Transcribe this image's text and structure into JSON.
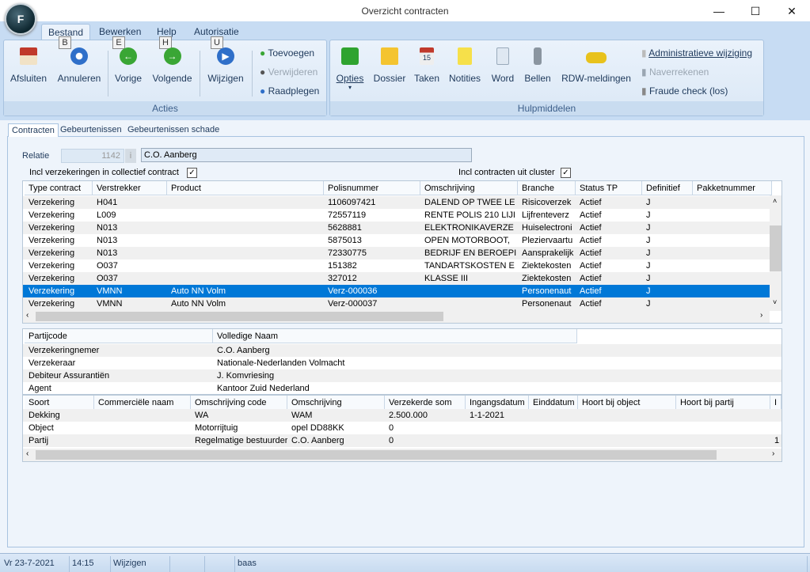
{
  "window": {
    "title": "Overzicht contracten",
    "minimize": "—",
    "maximize": "☐",
    "close": "✕",
    "app_letter": "F"
  },
  "ribbon": {
    "tabs": [
      "Bestand",
      "Bewerken",
      "Help",
      "Autorisatie"
    ],
    "keytips": [
      "B",
      "E",
      "H",
      "U"
    ],
    "acties": {
      "label": "Acties",
      "buttons": [
        "Afsluiten",
        "Annuleren",
        "Vorige",
        "Volgende",
        "Wijzigen"
      ],
      "small": [
        "Toevoegen",
        "Verwijderen",
        "Raadplegen"
      ]
    },
    "hulpmiddelen": {
      "label": "Hulpmiddelen",
      "buttons": [
        "Opties",
        "Dossier",
        "Taken",
        "Notities",
        "Word",
        "Bellen",
        "RDW-meldingen"
      ],
      "small": [
        "Administratieve wijziging",
        "Naverrekenen",
        "Fraude check (los)"
      ]
    }
  },
  "page_tabs": [
    "Contracten",
    "Gebeurtenissen",
    "Gebeurtenissen schade"
  ],
  "relatie": {
    "label": "Relatie",
    "number": "1142",
    "name": "C.O. Aanberg"
  },
  "options": {
    "collectief_label": "Incl verzekeringen in collectief contract",
    "collectief_checked": true,
    "cluster_label": "Incl contracten uit cluster",
    "cluster_checked": true,
    "check": "✓"
  },
  "contracts": {
    "columns": [
      "Type contract",
      "Verstrekker",
      "Product",
      "Polisnummer",
      "Omschrijving",
      "Branche",
      "Status TP",
      "Definitief",
      "Pakketnummer"
    ],
    "rows": [
      [
        "Verzekering",
        "H041",
        "",
        "1106097421",
        "DALEND OP TWEE LE",
        "Risicoverzek",
        "Actief",
        "J",
        ""
      ],
      [
        "Verzekering",
        "L009",
        "",
        "72557119",
        "RENTE POLIS 210 LIJI",
        "Lijfrenteverz",
        "Actief",
        "J",
        ""
      ],
      [
        "Verzekering",
        "N013",
        "",
        "5628881",
        "ELEKTRONIKAVERZE",
        "Huiselectroni",
        "Actief",
        "J",
        ""
      ],
      [
        "Verzekering",
        "N013",
        "",
        "5875013",
        "OPEN MOTORBOOT,",
        "Pleziervaartu",
        "Actief",
        "J",
        ""
      ],
      [
        "Verzekering",
        "N013",
        "",
        "72330775",
        "BEDRIJF EN BEROEPI",
        "Aansprakelijk",
        "Actief",
        "J",
        ""
      ],
      [
        "Verzekering",
        "O037",
        "",
        "151382",
        "TANDARTSKOSTEN E",
        "Ziektekosten",
        "Actief",
        "J",
        ""
      ],
      [
        "Verzekering",
        "O037",
        "",
        "327012",
        "KLASSE III",
        "Ziektekosten",
        "Actief",
        "J",
        ""
      ],
      [
        "Verzekering",
        "VMNN",
        "Auto NN Volm",
        "Verz-000036",
        "",
        "Personenaut",
        "Actief",
        "J",
        ""
      ],
      [
        "Verzekering",
        "VMNN",
        "Auto NN Volm",
        "Verz-000037",
        "",
        "Personenaut",
        "Actief",
        "J",
        ""
      ]
    ],
    "selected_index": 7
  },
  "parties": {
    "columns": [
      "Partijcode",
      "Volledige Naam"
    ],
    "rows": [
      [
        "Verzekeringnemer",
        "C.O. Aanberg"
      ],
      [
        "Verzekeraar",
        "Nationale-Nederlanden Volmacht"
      ],
      [
        "Debiteur Assurantiën",
        "J. Komvriesing"
      ],
      [
        "Agent",
        "Kantoor Zuid Nederland"
      ]
    ]
  },
  "details": {
    "columns": [
      "Soort",
      "Commerciële naam",
      "Omschrijving code",
      "Omschrijving",
      "Verzekerde som",
      "Ingangsdatum",
      "Einddatum",
      "Hoort bij object",
      "Hoort bij partij",
      "I"
    ],
    "rows": [
      [
        "Dekking",
        "",
        "WA",
        "WAM",
        "2.500.000",
        "1-1-2021",
        "",
        "",
        "",
        ""
      ],
      [
        "Object",
        "",
        "Motorrijtuig",
        "opel DD88KK",
        "0",
        "",
        "",
        "",
        "",
        ""
      ],
      [
        "Partij",
        "",
        "Regelmatige bestuurder",
        "C.O. Aanberg",
        "0",
        "",
        "",
        "",
        "",
        "1"
      ]
    ]
  },
  "statusbar": [
    "Vr 23-7-2021",
    "14:15",
    "Wijzigen",
    "",
    "",
    "baas"
  ]
}
